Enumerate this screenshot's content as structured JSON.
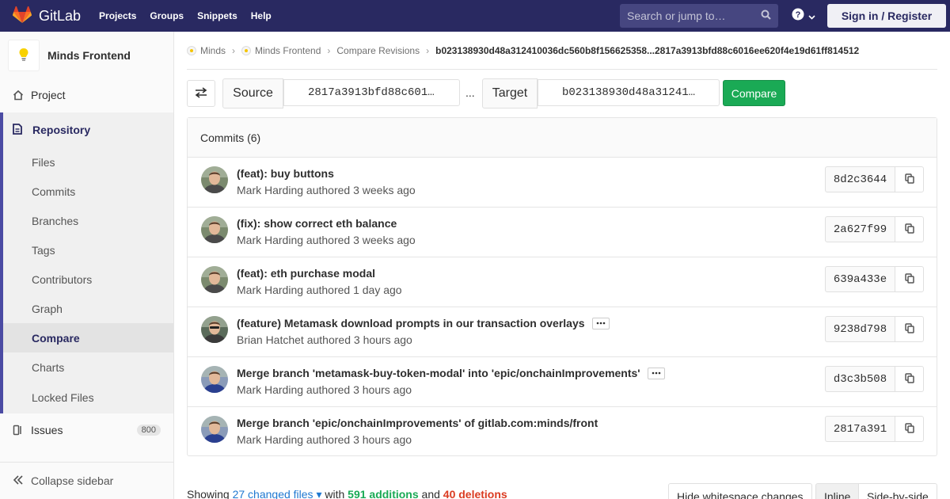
{
  "navbar": {
    "brand": "GitLab",
    "links": [
      "Projects",
      "Groups",
      "Snippets",
      "Help"
    ],
    "search_placeholder": "Search or jump to…",
    "signin": "Sign in / Register",
    "bg_color": "#292961"
  },
  "sidebar": {
    "project_name": "Minds Frontend",
    "project_label": "Project",
    "repository_label": "Repository",
    "repo_items": [
      "Files",
      "Commits",
      "Branches",
      "Tags",
      "Contributors",
      "Graph",
      "Compare",
      "Charts",
      "Locked Files"
    ],
    "active_item": "Compare",
    "issues_label": "Issues",
    "issues_count": "800",
    "collapse_label": "Collapse sidebar"
  },
  "breadcrumb": {
    "group": "Minds",
    "project": "Minds Frontend",
    "section": "Compare Revisions",
    "current": "b023138930d48a312410036dc560b8f156625358...2817a3913bfd88c6016ee620f4e19d61ff814512"
  },
  "compare": {
    "source_label": "Source",
    "source_value": "2817a3913bfd88c601…",
    "separator": "...",
    "target_label": "Target",
    "target_value": "b023138930d48a31241…",
    "button": "Compare"
  },
  "commits": {
    "header": "Commits (6)",
    "items": [
      {
        "title": "(feat): buy buttons",
        "author": "Mark Harding",
        "verb": "authored",
        "time": "3 weeks ago",
        "sha": "8d2c3644",
        "has_more": false
      },
      {
        "title": "(fix): show correct eth balance",
        "author": "Mark Harding",
        "verb": "authored",
        "time": "3 weeks ago",
        "sha": "2a627f99",
        "has_more": false
      },
      {
        "title": "(feat): eth purchase modal",
        "author": "Mark Harding",
        "verb": "authored",
        "time": "1 day ago",
        "sha": "639a433e",
        "has_more": false
      },
      {
        "title": "(feature) Metamask download prompts in our transaction overlays",
        "author": "Brian Hatchet",
        "verb": "authored",
        "time": "3 hours ago",
        "sha": "9238d798",
        "has_more": true
      },
      {
        "title": "Merge branch 'metamask-buy-token-modal' into 'epic/onchainImprovements'",
        "author": "Mark Harding",
        "verb": "authored",
        "time": "3 hours ago",
        "sha": "d3c3b508",
        "has_more": true
      },
      {
        "title": "Merge branch 'epic/onchainImprovements' of gitlab.com:minds/front",
        "author": "Mark Harding",
        "verb": "authored",
        "time": "3 hours ago",
        "sha": "2817a391",
        "has_more": false
      }
    ]
  },
  "summary": {
    "showing": "Showing",
    "files": "27 changed files",
    "with": "with",
    "additions": "591 additions",
    "and": "and",
    "deletions": "40 deletions"
  },
  "view_controls": {
    "whitespace": "Hide whitespace changes",
    "inline": "Inline",
    "side_by_side": "Side-by-side"
  }
}
